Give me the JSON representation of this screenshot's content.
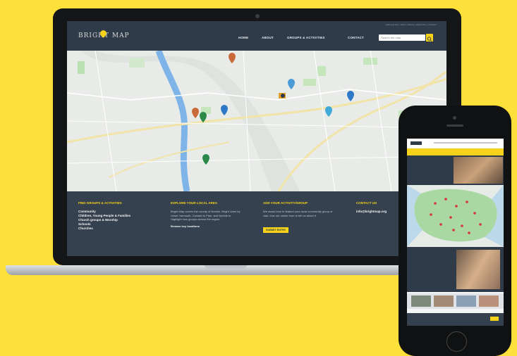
{
  "site": {
    "logo": "BRIGHT MAP",
    "top_links": "Add a group | Add a listing | Advertise | Contact",
    "nav": [
      "HOME",
      "ABOUT",
      "GROUPS & ACTIVITIES",
      "CONTACT"
    ],
    "search_placeholder": "Search the map"
  },
  "footer": {
    "col1": {
      "heading": "FIND GROUPS & ACTIVITIES",
      "links": [
        "Community",
        "Children, Young People & Families",
        "Church groups & Worship",
        "Schools",
        "Churches"
      ]
    },
    "col2": {
      "heading": "EXPLORE YOUR LOCAL AREA",
      "text": "Bright Map covers the county of Norfolk. Bright Lives by Unset Yarmouth. Contact to Plan, and Norfolk to Highlight how groups across the region.",
      "link": "Browse key locations"
    },
    "col3": {
      "heading": "ADD YOUR ACTIVITY/GROUP",
      "text": "We would love to feature your local community group or club. Use our online form to tell us about it.",
      "button": "SUBMIT ENTRY"
    },
    "col4": {
      "heading": "CONTACT US",
      "email": "info@brightmap.org"
    }
  },
  "colors": {
    "background": "#fde13a",
    "accent": "#f6d21b",
    "header": "#2f3b49",
    "footer": "#36414f"
  }
}
